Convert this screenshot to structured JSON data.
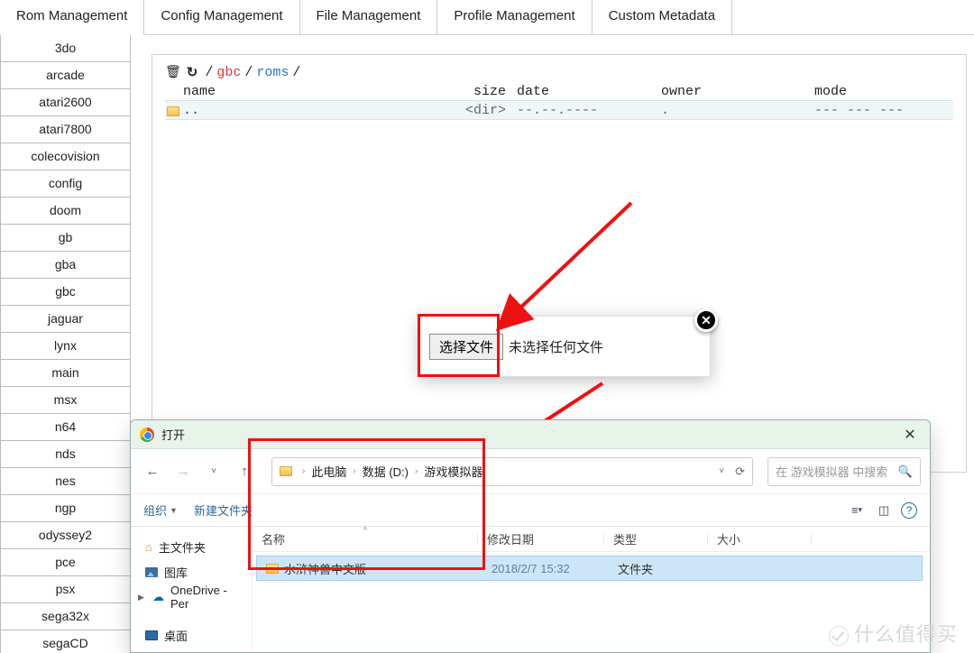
{
  "tabs": [
    "Rom Management",
    "Config Management",
    "File Management",
    "Profile Management",
    "Custom Metadata"
  ],
  "systems": [
    "3do",
    "arcade",
    "atari2600",
    "atari7800",
    "colecovision",
    "config",
    "doom",
    "gb",
    "gba",
    "gbc",
    "jaguar",
    "lynx",
    "main",
    "msx",
    "n64",
    "nds",
    "nes",
    "ngp",
    "odyssey2",
    "pce",
    "psx",
    "sega32x",
    "segaCD"
  ],
  "path": {
    "seg1": "gbc",
    "seg2": "roms"
  },
  "cols": {
    "name": "name",
    "size": "size",
    "date": "date",
    "owner": "owner",
    "mode": "mode"
  },
  "row": {
    "name": "..",
    "size": "<dir>",
    "date": "--.--.----",
    "owner": ".",
    "mode": "--- --- ---"
  },
  "chooser": {
    "btn": "选择文件",
    "txt": "未选择任何文件"
  },
  "os": {
    "title": "打开",
    "crumbs": [
      "此电脑",
      "数据 (D:)",
      "游戏模拟器"
    ],
    "search_ph": "在 游戏模拟器 中搜索",
    "org": "组织",
    "newf": "新建文件夹",
    "side": {
      "home": "主文件夹",
      "gallery": "图库",
      "onedrive": "OneDrive - Per",
      "desktop": "桌面"
    },
    "hdr": {
      "name": "名称",
      "date": "修改日期",
      "type": "类型",
      "size": "大小"
    },
    "item": {
      "name": "水浒神兽中文版",
      "date": "2018/2/7 15:32",
      "type": "文件夹",
      "size": ""
    }
  },
  "wm": "什么值得买"
}
